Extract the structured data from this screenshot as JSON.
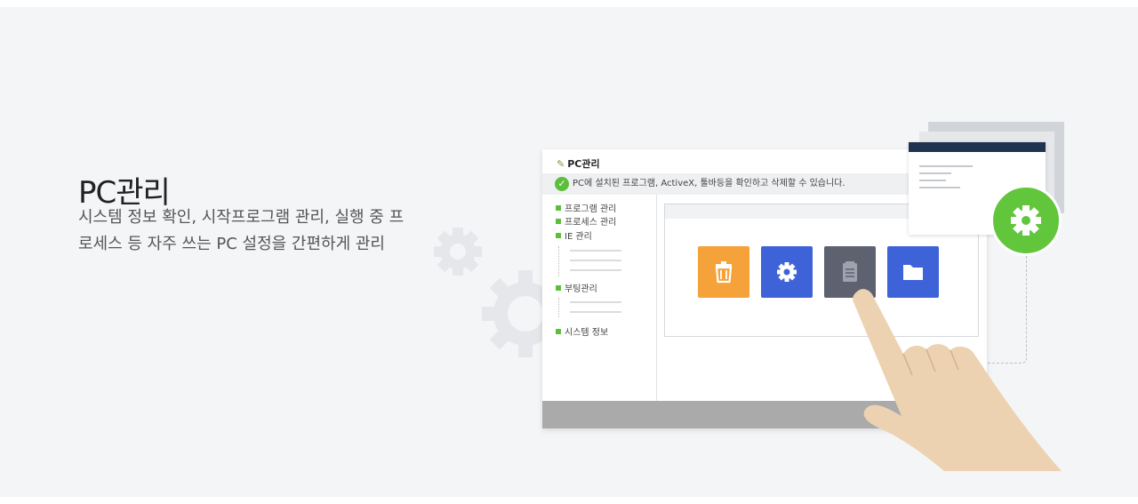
{
  "hero": {
    "title": "PC관리",
    "description": "시스템 정보 확인, 시작프로그램 관리, 실행 중 프로세스 등 자주 쓰는 PC 설정을 간편하게 관리"
  },
  "window": {
    "title": "PC관리",
    "status_message": "PC에 설치된 프로그램, ActiveX, 툴바등을 확인하고 삭제할 수 있습니다.",
    "tree_items": [
      "프로그램 관리",
      "프로세스 관리",
      "IE 관리",
      "부팅관리",
      "시스템 정보"
    ],
    "tiles": [
      {
        "icon": "trash-icon",
        "color": "#f5a23a"
      },
      {
        "icon": "gear-icon",
        "color": "#3e63d8"
      },
      {
        "icon": "notepad-icon",
        "color": "#5d6170"
      },
      {
        "icon": "folder-icon",
        "color": "#3e63d8"
      }
    ]
  },
  "colors": {
    "accent_green": "#62c63c",
    "background": "#f4f5f7",
    "navy": "#1f3250"
  }
}
